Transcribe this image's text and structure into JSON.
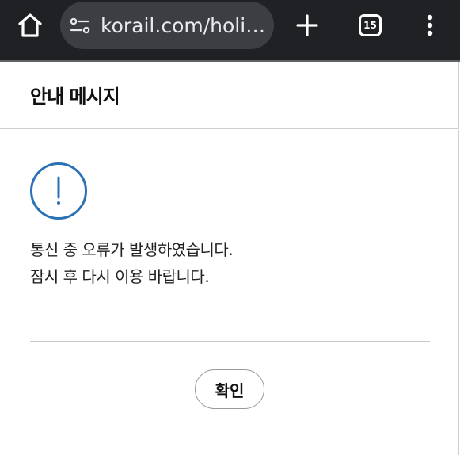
{
  "browser": {
    "url": "korail.com/holiday/",
    "tab_count": "15",
    "icons": [
      "home-icon",
      "site-settings-icon",
      "plus-icon",
      "tab-switcher-icon",
      "more-vert-icon"
    ]
  },
  "dialog": {
    "title": "안내 메시지",
    "message_line1": "통신 중 오류가 발생하였습니다.",
    "message_line2": "잠시 후 다시 이용 바랍니다.",
    "confirm_label": "확인",
    "icon": "exclamation-circle-icon",
    "accent_color": "#2a72b5"
  }
}
